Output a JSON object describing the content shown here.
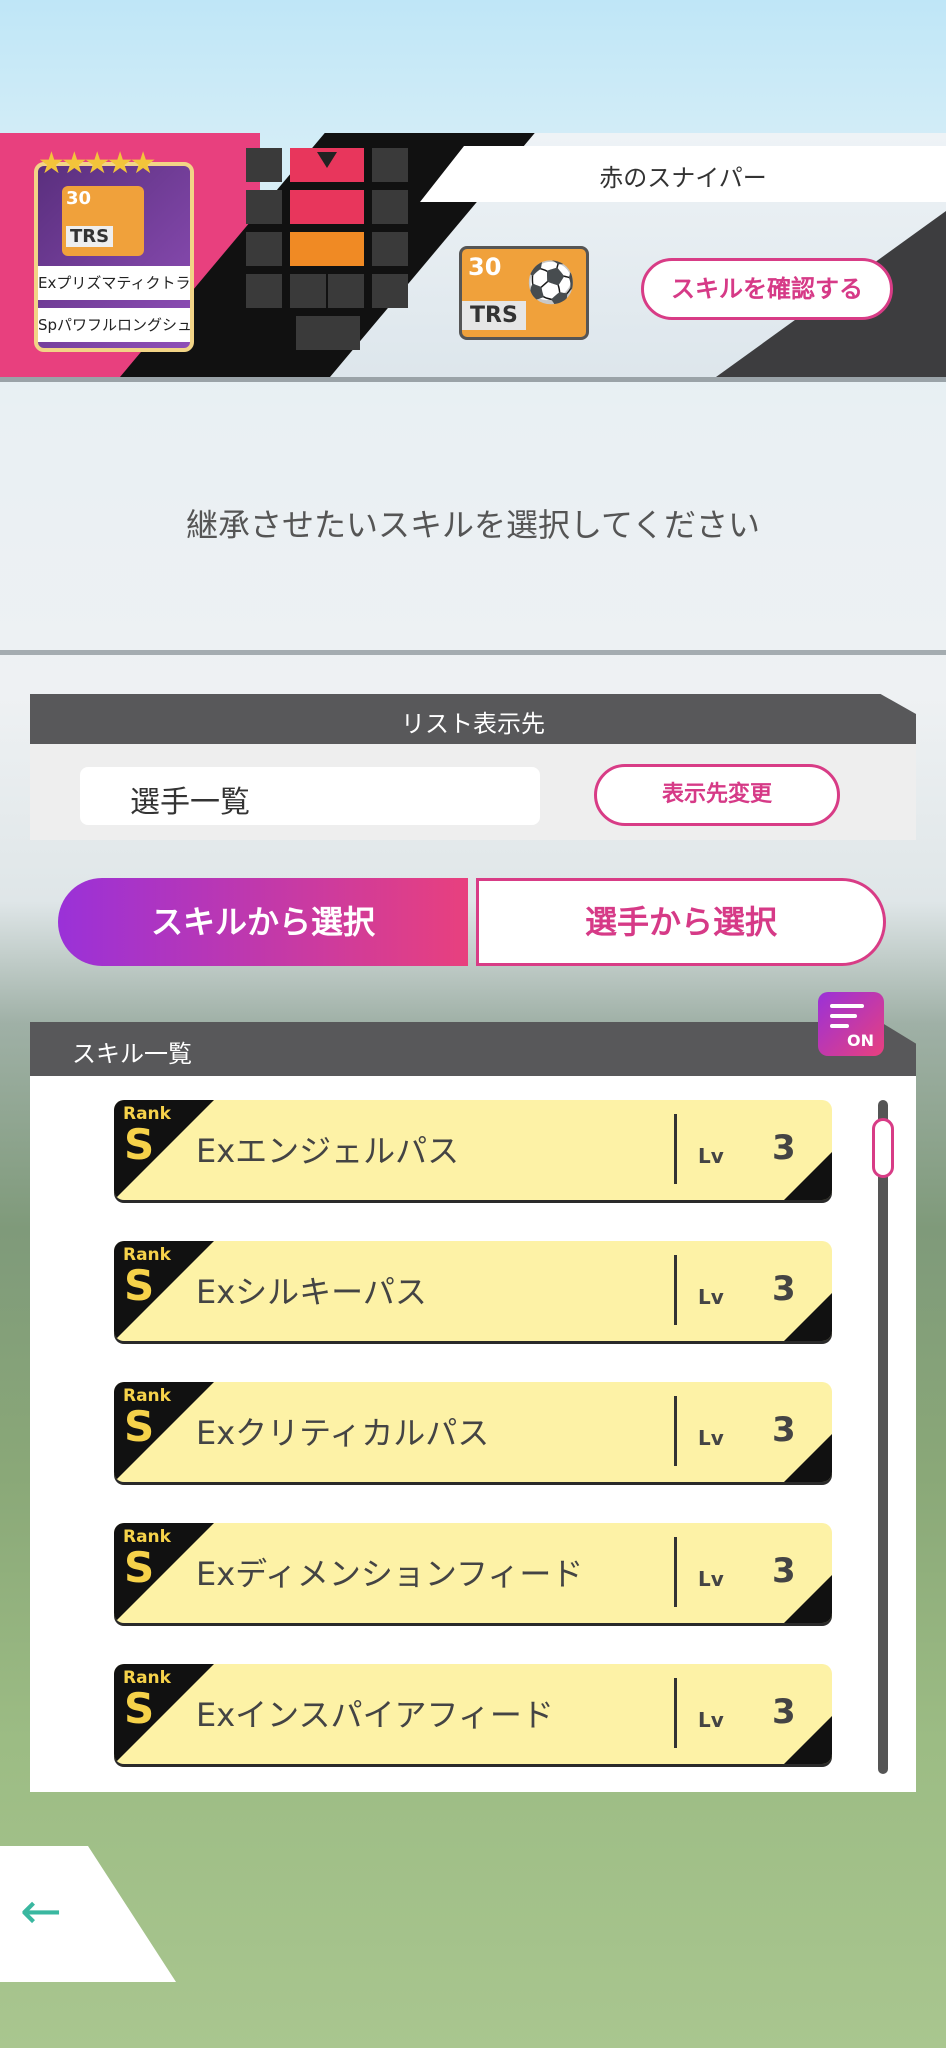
{
  "player": {
    "name": "赤のスナイパー",
    "card_skill_1": "Exプリズマティクトラップ",
    "card_skill_2": "Spパワフルロングシュート",
    "card_level": "30",
    "card_code": "TRS",
    "stars": "★★★★★"
  },
  "skill_icon": {
    "level": "30",
    "code": "TRS"
  },
  "buttons": {
    "confirm_skill": "スキルを確認する",
    "change_destination": "表示先変更",
    "back": "←"
  },
  "instruction": "継承させたいスキルを選択してください",
  "list_destination": {
    "header": "リスト表示先",
    "value": "選手一覧"
  },
  "toggle": {
    "left": "スキルから選択",
    "right": "選手から選択"
  },
  "skill_list": {
    "header": "スキル一覧",
    "filter_label": "ON",
    "rank_label": "Rank",
    "lv_label": "Lv",
    "items": [
      {
        "rank": "S",
        "name": "Exエンジェルパス",
        "level": "3"
      },
      {
        "rank": "S",
        "name": "Exシルキーパス",
        "level": "3"
      },
      {
        "rank": "S",
        "name": "Exクリティカルパス",
        "level": "3"
      },
      {
        "rank": "S",
        "name": "Exディメンションフィード",
        "level": "3"
      },
      {
        "rank": "S",
        "name": "Exインスパイアフィード",
        "level": "3"
      }
    ]
  },
  "colors": {
    "accent_pink": "#d83c86",
    "accent_purple": "#9a31d8",
    "row_yellow": "#fdf2a6"
  }
}
